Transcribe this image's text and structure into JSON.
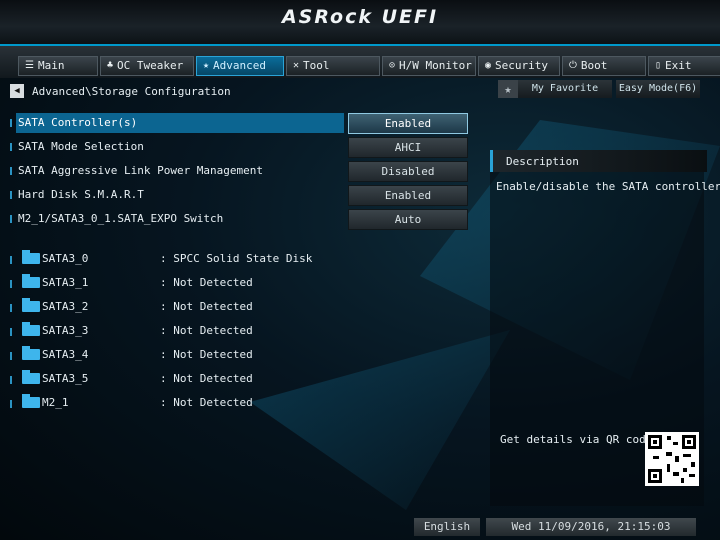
{
  "header": {
    "brand": "ASRock UEFI"
  },
  "nav": {
    "tabs": [
      {
        "icon": "☰",
        "label": "Main"
      },
      {
        "icon": "♣",
        "label": "OC Tweaker"
      },
      {
        "icon": "★",
        "label": "Advanced",
        "active": true
      },
      {
        "icon": "✕",
        "label": "Tool"
      },
      {
        "icon": "⊙",
        "label": "H/W Monitor"
      },
      {
        "icon": "◉",
        "label": "Security"
      },
      {
        "icon": "⏻",
        "label": "Boot"
      },
      {
        "icon": "▯",
        "label": "Exit"
      }
    ]
  },
  "breadcrumb": {
    "path": "Advanced\\Storage Configuration"
  },
  "favorite": {
    "label": "My Favorite"
  },
  "easy_mode": {
    "label": "Easy Mode(F6)"
  },
  "settings": [
    {
      "label": "SATA Controller(s)",
      "value": "Enabled"
    },
    {
      "label": "SATA Mode Selection",
      "value": "AHCI"
    },
    {
      "label": "SATA Aggressive Link Power Management",
      "value": "Disabled"
    },
    {
      "label": "Hard Disk S.M.A.R.T",
      "value": "Enabled"
    },
    {
      "label": "M2_1/SATA3_0_1.SATA_EXPO Switch",
      "value": "Auto"
    }
  ],
  "drives": [
    {
      "name": "SATA3_0",
      "status": ": SPCC Solid State Disk"
    },
    {
      "name": "SATA3_1",
      "status": ": Not Detected"
    },
    {
      "name": "SATA3_2",
      "status": ": Not Detected"
    },
    {
      "name": "SATA3_3",
      "status": ": Not Detected"
    },
    {
      "name": "SATA3_4",
      "status": ": Not Detected"
    },
    {
      "name": "SATA3_5",
      "status": ": Not Detected"
    },
    {
      "name": "M2_1",
      "status": ": Not Detected"
    }
  ],
  "description": {
    "title": "Description",
    "text": "Enable/disable the SATA controllers.",
    "qr_hint": "Get details via QR code"
  },
  "footer": {
    "language": "English",
    "datetime": "Wed 11/09/2016, 21:15:03"
  },
  "colors": {
    "accent": "#2aa3d6",
    "selection": "#0c6591"
  }
}
